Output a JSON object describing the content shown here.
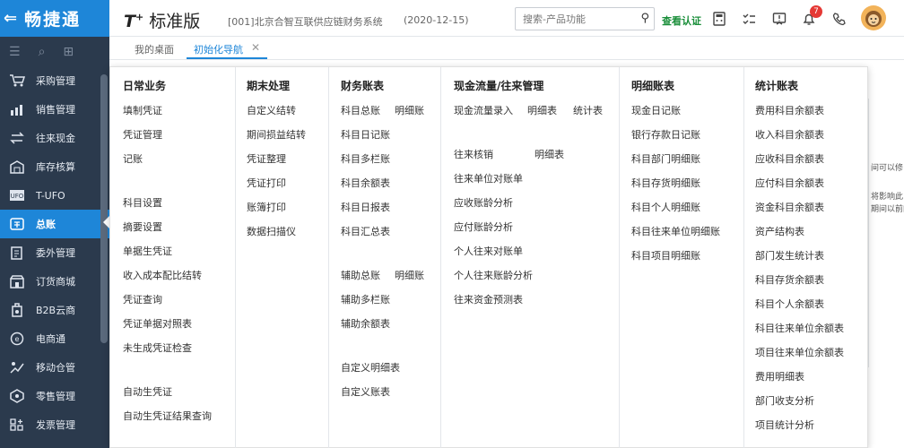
{
  "logo": {
    "arrow": "⇐",
    "text": "畅捷通"
  },
  "header": {
    "product_mark": "T",
    "product_plus": "+",
    "product_name": "标准版",
    "account": "[001]北京合智互联供应链财务系统",
    "date": "(2020-12-15)",
    "search_placeholder": "搜索-产品功能",
    "verify_label": "查看认证",
    "notification_count": "7"
  },
  "sidebar": {
    "items": [
      {
        "label": "采购管理",
        "icon": "cart-icon"
      },
      {
        "label": "销售管理",
        "icon": "chart-icon"
      },
      {
        "label": "往来现金",
        "icon": "exchange-icon"
      },
      {
        "label": "库存核算",
        "icon": "warehouse-icon"
      },
      {
        "label": "T-UFO",
        "icon": "ufo-icon"
      },
      {
        "label": "总账",
        "icon": "ledger-icon"
      },
      {
        "label": "委外管理",
        "icon": "outsource-icon"
      },
      {
        "label": "订货商城",
        "icon": "store-icon"
      },
      {
        "label": "B2B云商",
        "icon": "b2b-icon"
      },
      {
        "label": "电商通",
        "icon": "ecommerce-icon"
      },
      {
        "label": "移动仓管",
        "icon": "mobile-warehouse-icon"
      },
      {
        "label": "零售管理",
        "icon": "retail-icon"
      },
      {
        "label": "发票管理",
        "icon": "invoice-icon"
      }
    ]
  },
  "tabs": [
    {
      "label": "我的桌面"
    },
    {
      "label": "初始化导航"
    }
  ],
  "background_text": [
    "间可以修",
    "将影响此",
    "期间以前的"
  ],
  "menu": {
    "columns": [
      {
        "title": "日常业务",
        "items": [
          "填制凭证",
          "凭证管理",
          "记账",
          "科目设置",
          "摘要设置",
          "单据生凭证",
          "收入成本配比结转",
          "凭证查询",
          "凭证单据对照表",
          "未生成凭证检查",
          "自动生凭证",
          "自动生凭证结果查询"
        ]
      },
      {
        "title": "期末处理",
        "items": [
          "自定义结转",
          "期间损益结转",
          "凭证整理",
          "凭证打印",
          "账簿打印",
          "数据扫描仪"
        ]
      },
      {
        "title": "财务账表",
        "items": [
          "科目总账",
          "明细账",
          "科目日记账",
          "科目多栏账",
          "科目余额表",
          "科目日报表",
          "科目汇总表",
          "辅助总账",
          "明细账",
          "辅助多栏账",
          "辅助余额表",
          "自定义明细表",
          "自定义账表"
        ]
      },
      {
        "title": "现金流量/往来管理",
        "items": [
          "现金流量录入",
          "明细表",
          "统计表",
          "往来核销",
          "明细表",
          "往来单位对账单",
          "应收账龄分析",
          "应付账龄分析",
          "个人往来对账单",
          "个人往来账龄分析",
          "往来资金预测表"
        ]
      },
      {
        "title": "明细账表",
        "items": [
          "现金日记账",
          "银行存款日记账",
          "科目部门明细账",
          "科目存货明细账",
          "科目个人明细账",
          "科目往来单位明细账",
          "科目项目明细账"
        ]
      },
      {
        "title": "统计账表",
        "items": [
          "费用科目余额表",
          "收入科目余额表",
          "应收科目余额表",
          "应付科目余额表",
          "资金科目余额表",
          "资产结构表",
          "部门发生统计表",
          "科目存货余额表",
          "科目个人余额表",
          "科目往来单位余额表",
          "项目往来单位余额表",
          "费用明细表",
          "部门收支分析",
          "项目统计分析"
        ]
      }
    ]
  }
}
